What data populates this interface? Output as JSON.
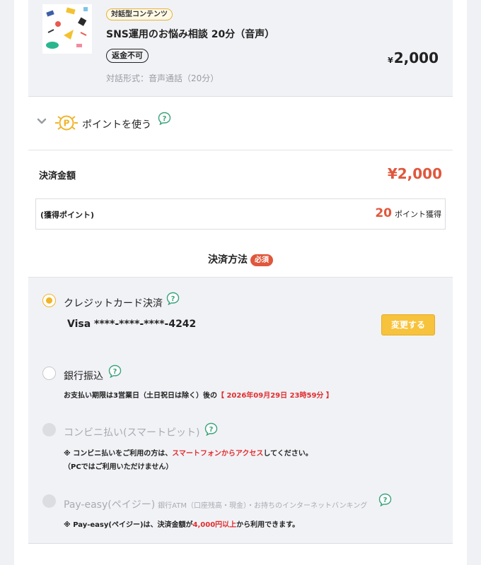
{
  "product": {
    "type_badge": "対話型コンテンツ",
    "title": "SNS運用のお悩み相談 20分（音声）",
    "refund_badge": "返金不可",
    "price_symbol": "¥",
    "price": "2,000",
    "format": "対話形式：音声通話（20分）"
  },
  "points": {
    "label": "ポイントを使う",
    "coin_icon": "P"
  },
  "total": {
    "label": "決済金額",
    "amount": "¥2,000",
    "earn_label": "(獲得ポイント)",
    "earn_value": "20",
    "earn_unit": "ポイント獲得"
  },
  "payment": {
    "title": "決済方法",
    "required_badge": "必須",
    "credit": {
      "label": "クレジットカード決済",
      "card": "Visa ****-****-****-4242",
      "change_button": "変更する",
      "selected": true
    },
    "bank": {
      "label": "銀行振込",
      "note_prefix": "お支払い期限は3営業日（土日祝日は除く）後の",
      "note_deadline": "【 2026年09月29日 23時59分 】"
    },
    "convenience": {
      "label": "コンビニ払い(スマートピット)",
      "note_prefix": "※ コンビニ払いをご利用の方は、",
      "note_highlight": "スマートフォンからアクセス",
      "note_suffix": "してください。",
      "note_line2": "（PCではご利用いただけません）"
    },
    "payeasy": {
      "label": "Pay-easy(ペイジー)",
      "sub": "銀行ATM（口座残高・現金）・お持ちのインターネットバンキング",
      "note_prefix": "※ Pay-easy(ペイジー)は、決済金額が",
      "note_highlight": "4,000円以上",
      "note_suffix": "から利用できます。"
    }
  },
  "colors": {
    "accent": "#f0b428",
    "price_red": "#e0573c",
    "help_green": "#3aa37a"
  }
}
